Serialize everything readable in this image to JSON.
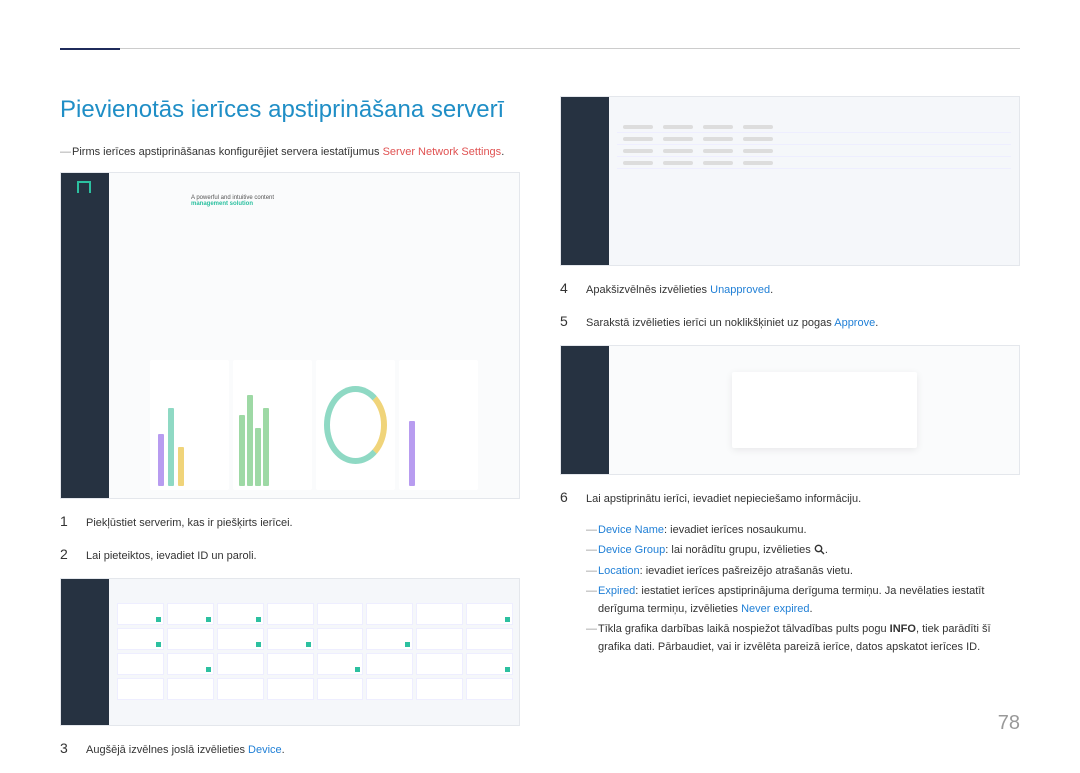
{
  "page_number": "78",
  "title": "Pievienotās ierīces apstiprināšana serverī",
  "intro_note_prefix": "Pirms ierīces apstiprināšanas konfigurējiet servera iestatījumus ",
  "intro_note_link": "Server Network Settings",
  "intro_note_suffix": ".",
  "steps": {
    "s1": {
      "num": "1",
      "text": "Piekļūstiet serverim, kas ir piešķirts ierīcei."
    },
    "s2": {
      "num": "2",
      "text": "Lai pieteiktos, ievadiet ID un paroli."
    },
    "s3": {
      "num": "3",
      "text_prefix": "Augšējā izvēlnes joslā izvēlieties ",
      "link": "Device",
      "text_suffix": "."
    },
    "s4": {
      "num": "4",
      "text_prefix": "Apakšizvēlnēs izvēlieties ",
      "link": "Unapproved",
      "text_suffix": "."
    },
    "s5": {
      "num": "5",
      "text_prefix": "Sarakstā izvēlieties ierīci un noklikšķiniet uz pogas ",
      "link": "Approve",
      "text_suffix": "."
    },
    "s6": {
      "num": "6",
      "text": "Lai apstiprinātu ierīci, ievadiet nepieciešamo informāciju."
    }
  },
  "sub_items": {
    "a": {
      "label": "Device Name",
      "text": ": ievadiet ierīces nosaukumu."
    },
    "b": {
      "label": "Device Group",
      "text_prefix": ": lai norādītu grupu, izvēlieties ",
      "text_suffix": "."
    },
    "c": {
      "label": "Location",
      "text": ": ievadiet ierīces pašreizējo atrašanās vietu."
    },
    "d": {
      "label": "Expired",
      "text_prefix": ": iestatiet ierīces apstiprinājuma derīguma termiņu. Ja nevēlaties iestatīt derīguma termiņu, izvēlieties ",
      "link": "Never expired",
      "text_suffix": "."
    },
    "e": {
      "text_prefix": "Tīkla grafika darbības laikā nospiežot tālvadības pults pogu ",
      "bold": "INFO",
      "text_suffix": ", tiek parādīti šī grafika dati. Pārbaudiet, vai ir izvēlēta pareizā ierīce, datos apskatot ierīces ID."
    }
  },
  "placeholder_hero": {
    "line1": "A powerful and intuitive content",
    "line2": "management solution"
  }
}
